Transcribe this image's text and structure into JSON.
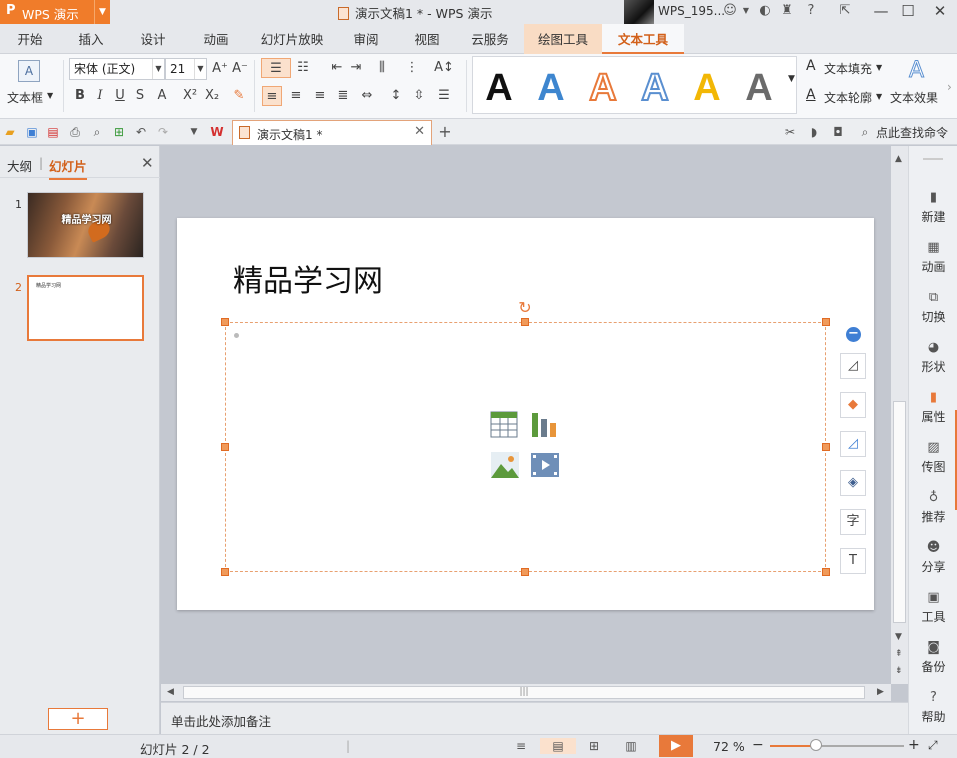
{
  "app": {
    "name": "WPS 演示",
    "logo": "P"
  },
  "window_title": "演示文稿1 * - WPS 演示",
  "user": {
    "name": "WPS_195..."
  },
  "tabs": [
    "开始",
    "插入",
    "设计",
    "动画",
    "幻灯片放映",
    "审阅",
    "视图",
    "云服务",
    "绘图工具",
    "文本工具"
  ],
  "active_tab": "文本工具",
  "ribbon": {
    "textbox_label": "文本框",
    "font_name": "宋体 (正文)",
    "font_size": "21",
    "text_fill": "文本填充",
    "text_outline": "文本轮廓",
    "text_effect": "文本效果",
    "styles_colors": [
      "#111111",
      "#3e86cf",
      "#e8793a",
      "#5a8fd0",
      "#f2b705",
      "#6b6b6b"
    ],
    "bold": "B",
    "italic": "I",
    "underline": "U",
    "strike": "S",
    "font_color_a": "A",
    "superscript": "X²",
    "subscript": "X₂"
  },
  "qat": {
    "doc_tab": "演示文稿1 *",
    "find_command": "点此查找命令"
  },
  "left_panel": {
    "outline_tab": "大纲",
    "slides_tab": "幻灯片",
    "thumbs": [
      {
        "num": "1",
        "text": "精品学习网"
      },
      {
        "num": "2",
        "text": "精品学习网"
      }
    ]
  },
  "slide": {
    "title": "精品学习网"
  },
  "notes_placeholder": "单击此处添加备注",
  "right_bar": [
    "新建",
    "动画",
    "切换",
    "形状",
    "属性",
    "传图",
    "推荐",
    "分享",
    "工具",
    "备份",
    "帮助"
  ],
  "status": {
    "slide_count": "幻灯片 2 / 2",
    "zoom": "72 %"
  },
  "accent_color": "#e8793a"
}
